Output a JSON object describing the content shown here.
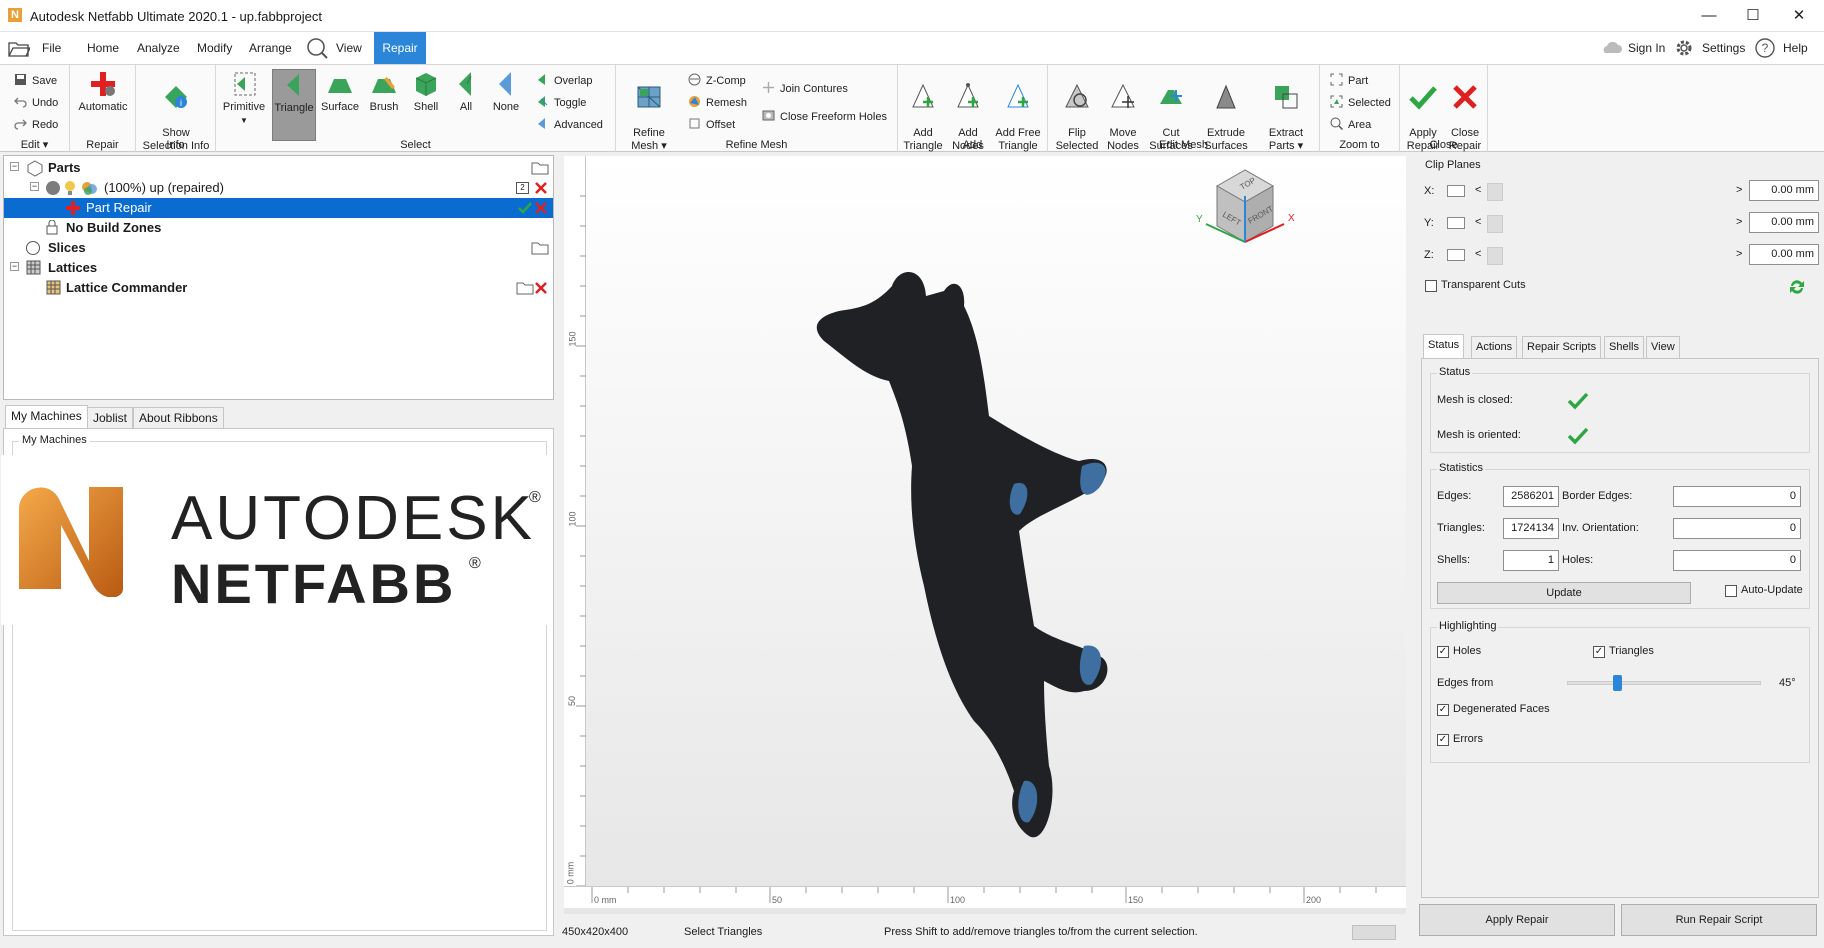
{
  "window": {
    "title": "Autodesk Netfabb Ultimate 2020.1 - up.fabbproject",
    "logo_letter": "N",
    "minimize": "—",
    "maximize": "☐",
    "close": "✕"
  },
  "menu": {
    "file": "File",
    "tabs": [
      "Home",
      "Analyze",
      "Modify",
      "Arrange",
      "View",
      "Repair"
    ],
    "active_tab": "Repair",
    "sign_in": "Sign In",
    "settings": "Settings",
    "help": "Help"
  },
  "ribbon": {
    "edit": {
      "save": "Save",
      "undo": "Undo",
      "redo": "Redo",
      "label": "Edit"
    },
    "repair": {
      "automatic": "Automatic",
      "label": "Repair"
    },
    "info": {
      "show_selection_info": "Show\nSelection Info",
      "label": "Info"
    },
    "select": {
      "primitive": "Primitive",
      "triangle": "Triangle",
      "surface": "Surface",
      "brush": "Brush",
      "shell": "Shell",
      "all": "All",
      "none": "None",
      "overlap": "Overlap",
      "toggle": "Toggle",
      "advanced": "Advanced",
      "label": "Select"
    },
    "refine_mesh": {
      "refine_mesh": "Refine\nMesh",
      "zcomp": "Z-Comp",
      "remesh": "Remesh",
      "offset": "Offset",
      "join_contures": "Join Contures",
      "close_freeform_holes": "Close Freeform Holes",
      "label": "Refine Mesh"
    },
    "add": {
      "add_triangle": "Add\nTriangle",
      "add_nodes": "Add\nNodes",
      "add_free_triangle": "Add Free\nTriangle",
      "label": "Add"
    },
    "edit_mesh": {
      "flip_selected": "Flip\nSelected",
      "move_nodes": "Move\nNodes",
      "cut_surfaces": "Cut\nSurfaces",
      "extrude_surfaces": "Extrude\nSurfaces",
      "extract_parts": "Extract\nParts",
      "label": "Edit Mesh"
    },
    "zoom_to": {
      "part": "Part",
      "selected": "Selected",
      "area": "Area",
      "label": "Zoom to"
    },
    "close": {
      "apply_repair": "Apply\nRepair",
      "close_repair": "Close\nRepair",
      "label": "Close"
    }
  },
  "tree": {
    "parts": "Parts",
    "part_item": "(100%) up (repaired)",
    "part_badge": "2",
    "part_repair": "Part Repair",
    "no_build_zones": "No Build Zones",
    "slices": "Slices",
    "lattices": "Lattices",
    "lattice_commander": "Lattice Commander"
  },
  "left_tabs": [
    "My Machines",
    "Joblist",
    "About Ribbons"
  ],
  "left_tab_active": "My Machines",
  "my_machines_group": "My Machines",
  "splash": {
    "line1": "AUTODESK",
    "line2": "NETFABB",
    "reg": "®"
  },
  "viewport": {
    "ruler_left": [
      "150",
      "100",
      "50",
      "0 mm"
    ],
    "ruler_bottom": [
      "0 mm",
      "50",
      "100",
      "150",
      "200"
    ],
    "cube": {
      "top": "TOP",
      "left": "LEFT",
      "front": "FRONT",
      "x": "X",
      "y": "Y"
    }
  },
  "status_bar": {
    "dimensions": "450x420x400",
    "mode": "Select Triangles",
    "hint": "Press Shift to add/remove triangles to/from the current selection."
  },
  "clip_planes": {
    "title": "Clip Planes",
    "rows": [
      {
        "axis": "X:",
        "value": "0.00 mm"
      },
      {
        "axis": "Y:",
        "value": "0.00 mm"
      },
      {
        "axis": "Z:",
        "value": "0.00 mm"
      }
    ],
    "transparent_cuts": "Transparent Cuts"
  },
  "right_tabs": [
    "Status",
    "Actions",
    "Repair Scripts",
    "Shells",
    "View"
  ],
  "right_tab_active": "Status",
  "status": {
    "title": "Status",
    "mesh_closed": "Mesh is closed:",
    "mesh_oriented": "Mesh is oriented:"
  },
  "statistics": {
    "title": "Statistics",
    "edges_label": "Edges:",
    "edges": "2586201",
    "triangles_label": "Triangles:",
    "triangles": "1724134",
    "shells_label": "Shells:",
    "shells": "1",
    "border_edges_label": "Border Edges:",
    "border_edges": "0",
    "inv_orientation_label": "Inv. Orientation:",
    "inv_orientation": "0",
    "holes_label": "Holes:",
    "holes": "0",
    "update": "Update",
    "auto_update": "Auto-Update"
  },
  "highlighting": {
    "title": "Highlighting",
    "holes": "Holes",
    "triangles": "Triangles",
    "edges_from": "Edges from",
    "edges_value": "45°",
    "edges_fraction": 0.25,
    "degenerated_faces": "Degenerated Faces",
    "errors": "Errors"
  },
  "bottom_buttons": {
    "apply_repair": "Apply Repair",
    "run_repair_script": "Run Repair Script"
  },
  "colors": {
    "accent": "#2b85d8",
    "selection": "#0a6cd1",
    "check": "#2fa644",
    "x_red": "#e02020"
  }
}
